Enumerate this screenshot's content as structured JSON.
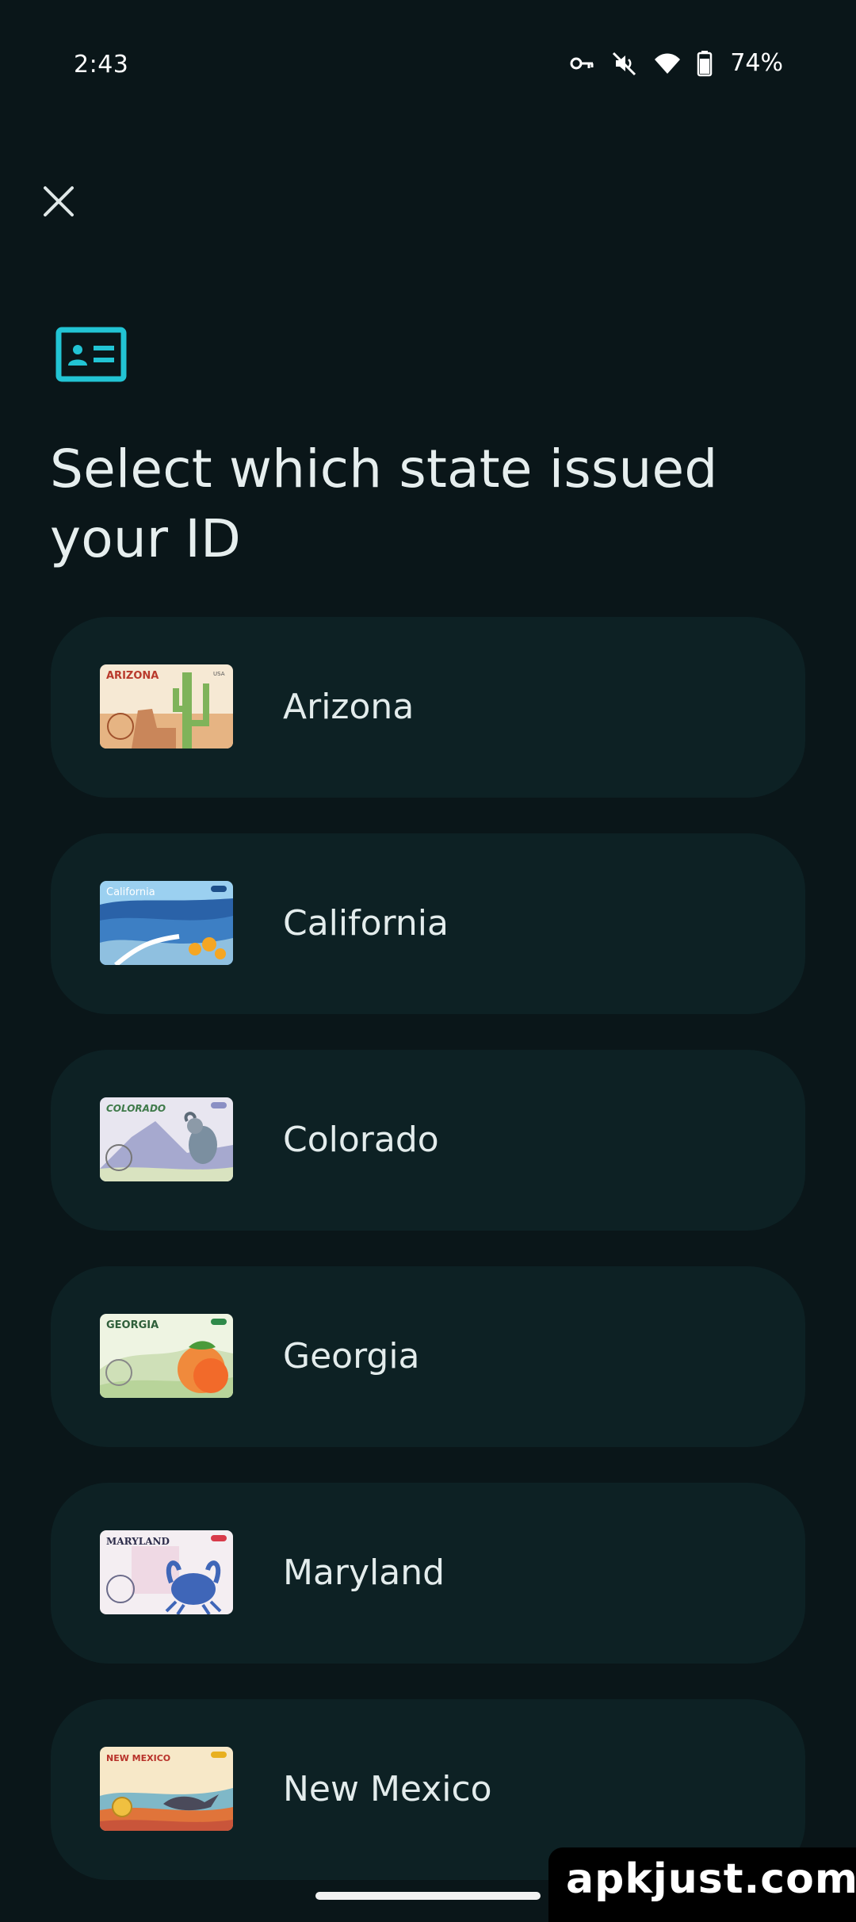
{
  "status_bar": {
    "time": "2:43",
    "battery_percent": "74%",
    "icons": [
      "vpn-key-icon",
      "mute-icon",
      "wifi-icon",
      "battery-icon"
    ]
  },
  "header": {
    "close_icon": "close-icon",
    "id_card_icon": "id-card-icon",
    "title": "Select which state issued your ID"
  },
  "colors": {
    "background": "#0a1619",
    "item_background": "#0d2124",
    "accent": "#22c4d4"
  },
  "states": [
    {
      "label": "Arizona",
      "card_title": "ARIZONA",
      "card_badge": "USA"
    },
    {
      "label": "California",
      "card_title": "California",
      "card_badge": ""
    },
    {
      "label": "Colorado",
      "card_title": "COLORADO",
      "card_badge": ""
    },
    {
      "label": "Georgia",
      "card_title": "GEORGIA",
      "card_badge": ""
    },
    {
      "label": "Maryland",
      "card_title": "MARYLAND",
      "card_badge": ""
    },
    {
      "label": "New Mexico",
      "card_title": "NEW MEXICO",
      "card_badge": ""
    }
  ],
  "watermark": "apkjust.com"
}
